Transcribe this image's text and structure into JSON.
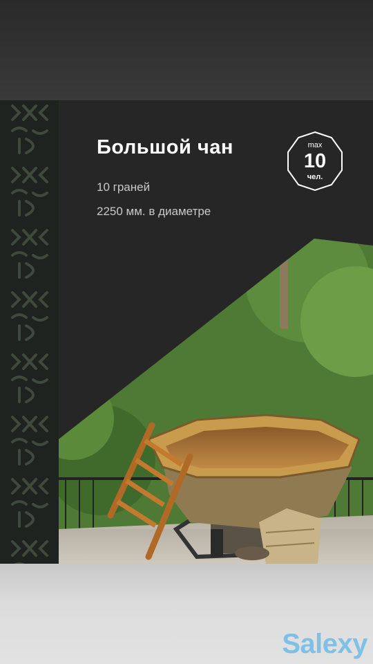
{
  "product": {
    "title": "Большой чан",
    "facets": "10 граней",
    "diameter": "2250 мм. в диаметре"
  },
  "capacity_badge": {
    "prefix": "max",
    "value": "10",
    "unit": "чел."
  },
  "watermark": "Salexy",
  "colors": {
    "card_bg": "#262626",
    "strip_bg": "#1f231f",
    "wood": "#b98a3e",
    "watermark": "#7ec0e6"
  }
}
